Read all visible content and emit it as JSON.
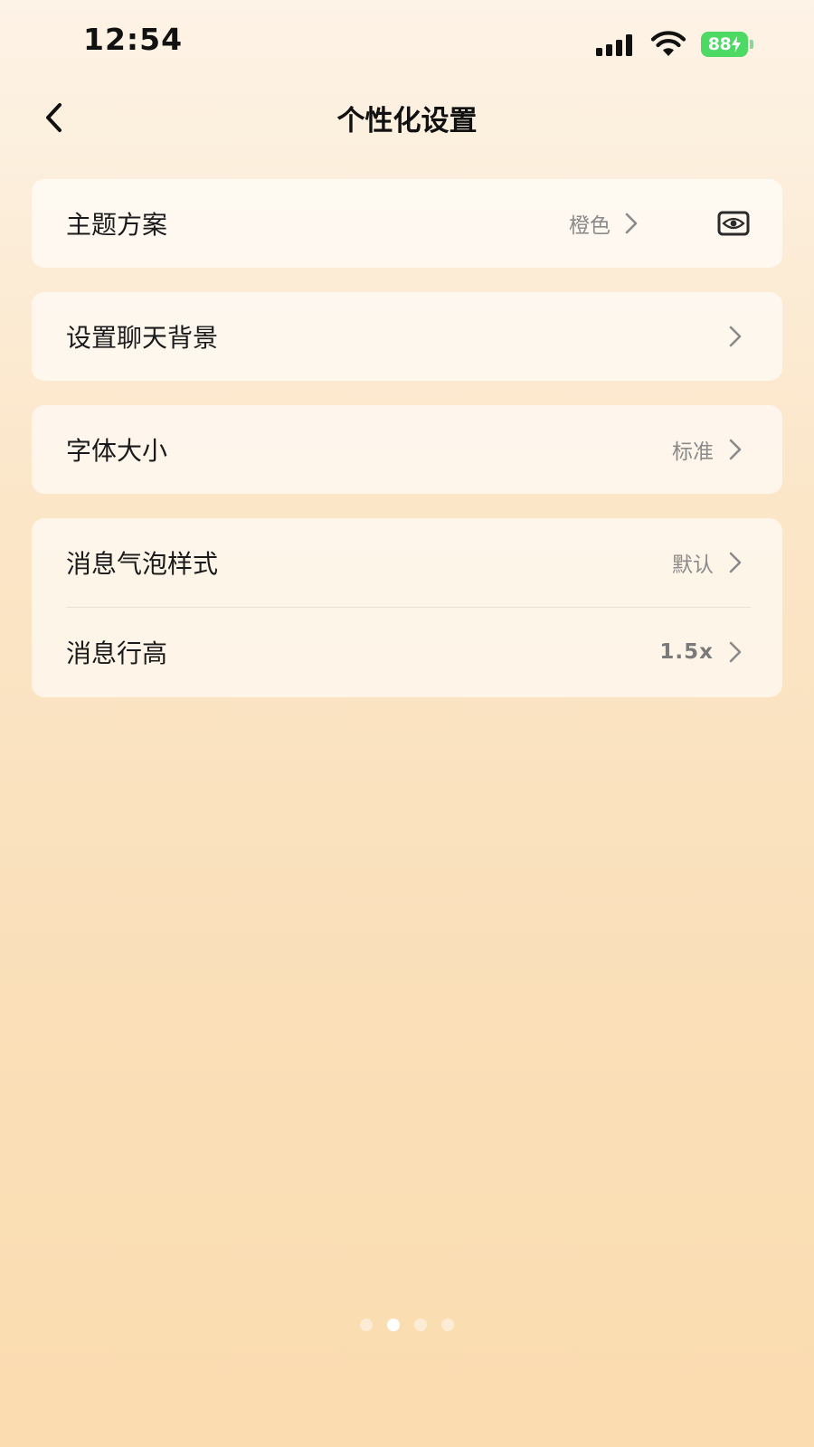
{
  "status_bar": {
    "time": "12:54",
    "battery_level": "88",
    "battery_charging": true,
    "battery_color": "#4cd964"
  },
  "nav": {
    "back_icon": "chevron-left-icon",
    "title": "个性化设置"
  },
  "settings": {
    "theme": {
      "label": "主题方案",
      "value": "橙色",
      "trailing_icon": "eye-icon"
    },
    "chat_background": {
      "label": "设置聊天背景"
    },
    "font_size": {
      "label": "字体大小",
      "value": "标准"
    },
    "bubble_style": {
      "label": "消息气泡样式",
      "value": "默认"
    },
    "line_height": {
      "label": "消息行高",
      "value": "1.5x"
    }
  },
  "pager": {
    "count": 4,
    "active_index": 1
  },
  "colors": {
    "background_top": "#fdf3e6",
    "background_bottom": "#fbdcb0",
    "card_background": "rgba(255,255,255,0.62)",
    "text_primary": "#1a1a1a",
    "text_secondary": "#8a8a8a"
  }
}
